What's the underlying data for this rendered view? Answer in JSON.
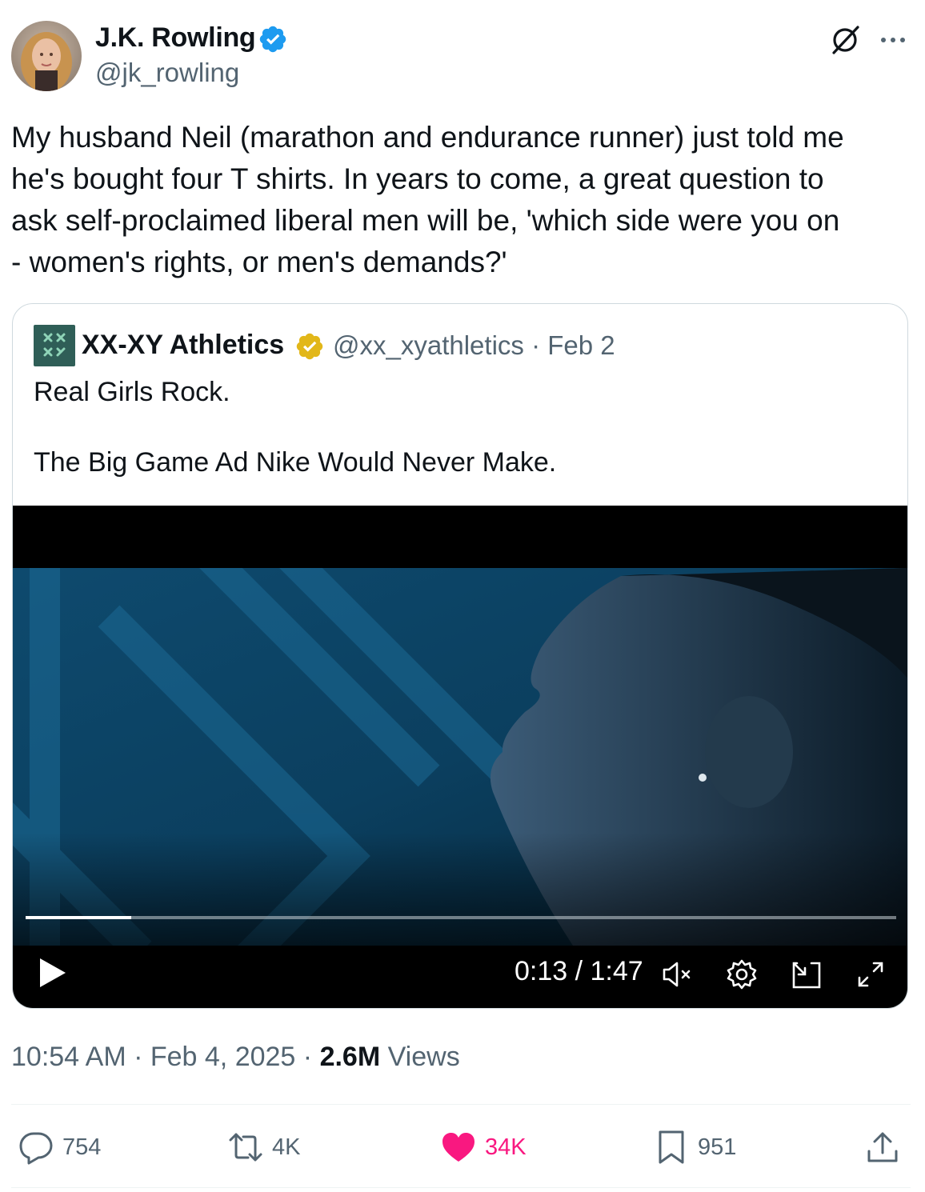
{
  "author": {
    "name": "J.K. Rowling",
    "handle": "@jk_rowling",
    "verified_color": "#1d9bf0"
  },
  "tweet": {
    "lines": [
      "My husband Neil (marathon and endurance runner) just told me",
      "he's bought four T shirts. In years to come, a great question to",
      "ask self-proclaimed liberal men will be, 'which side were you on",
      "- women's rights, or men's demands?'"
    ]
  },
  "quote": {
    "name": "XX-XY Athletics",
    "badge_color": "#e2b719",
    "handle": "@xx_xyathletics",
    "date": "Feb 2",
    "meta": "@xx_xyathletics · Feb 2",
    "text_line1": "Real Girls Rock.",
    "text_line2": "The Big Game Ad Nike Would Never Make."
  },
  "video": {
    "time_display": "0:13 / 1:47",
    "current": "0:13",
    "duration": "1:47",
    "progress_fraction": 0.121,
    "muted": true
  },
  "meta": {
    "time": "10:54 AM",
    "date": "Feb 4, 2025",
    "views_count": "2.6M",
    "views_label": "Views",
    "prefix": "10:54 AM · Feb 4, 2025 · "
  },
  "actions": {
    "replies": "754",
    "reposts": "4K",
    "likes": "34K",
    "bookmarks": "951",
    "like_color": "#f91880"
  },
  "icons": [
    "verified-icon",
    "grok-icon",
    "more-icon",
    "play-icon",
    "mute-icon",
    "settings-icon",
    "pip-icon",
    "fullscreen-icon",
    "reply-icon",
    "repost-icon",
    "like-icon",
    "bookmark-icon",
    "share-icon"
  ]
}
